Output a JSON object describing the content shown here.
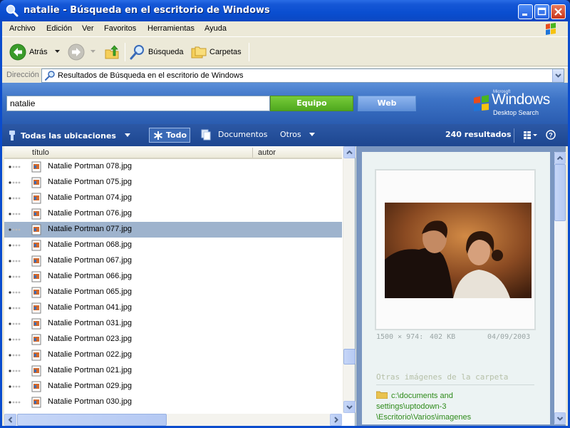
{
  "window": {
    "title": "natalie - Búsqueda en el escritorio de Windows"
  },
  "menu": [
    "Archivo",
    "Edición",
    "Ver",
    "Favoritos",
    "Herramientas",
    "Ayuda"
  ],
  "toolbar": {
    "back_label": "Atrás",
    "search_label": "Búsqueda",
    "folders_label": "Carpetas"
  },
  "address": {
    "label": "Dirección",
    "value": "Resultados de Búsqueda en el escritorio de Windows"
  },
  "search": {
    "query": "natalie",
    "btn_computer": "Equipo",
    "btn_web": "Web",
    "logo_microsoft": "Microsoft",
    "logo_windows": "Windows",
    "logo_desktop_search": "Desktop Search"
  },
  "filters": {
    "location": "Todas las ubicaciones",
    "all": "Todo",
    "documents": "Documentos",
    "others": "Otros",
    "count": "240 resultados"
  },
  "columns": {
    "title": "título",
    "author": "autor"
  },
  "results": [
    {
      "name": "Natalie Portman 078.jpg",
      "selected": false
    },
    {
      "name": "Natalie Portman 075.jpg",
      "selected": false
    },
    {
      "name": "Natalie Portman 074.jpg",
      "selected": false
    },
    {
      "name": "Natalie Portman 076.jpg",
      "selected": false
    },
    {
      "name": "Natalie Portman 077.jpg",
      "selected": true
    },
    {
      "name": "Natalie Portman 068.jpg",
      "selected": false
    },
    {
      "name": "Natalie Portman 067.jpg",
      "selected": false
    },
    {
      "name": "Natalie Portman 066.jpg",
      "selected": false
    },
    {
      "name": "Natalie Portman 065.jpg",
      "selected": false
    },
    {
      "name": "Natalie Portman 041.jpg",
      "selected": false
    },
    {
      "name": "Natalie Portman 031.jpg",
      "selected": false
    },
    {
      "name": "Natalie Portman 023.jpg",
      "selected": false
    },
    {
      "name": "Natalie Portman 022.jpg",
      "selected": false
    },
    {
      "name": "Natalie Portman 021.jpg",
      "selected": false
    },
    {
      "name": "Natalie Portman 029.jpg",
      "selected": false
    },
    {
      "name": "Natalie Portman 030.jpg",
      "selected": false
    }
  ],
  "preview": {
    "dimensions": "1500 × 974:",
    "size": "402 KB",
    "date": "04/09/2003",
    "other_images_title": "Otras imágenes de la carpeta",
    "folder_path_lines": [
      "c:\\documents and",
      "settings\\uptodown-3",
      "\\Escritorio\\Varios\\imagenes"
    ]
  },
  "colors": {
    "title_bar": "#0a4ed0",
    "search_band": "#3d73c6",
    "equipo_green": "#4fa81e",
    "selection": "#9eb3cd",
    "path_green": "#2e8b1a"
  }
}
